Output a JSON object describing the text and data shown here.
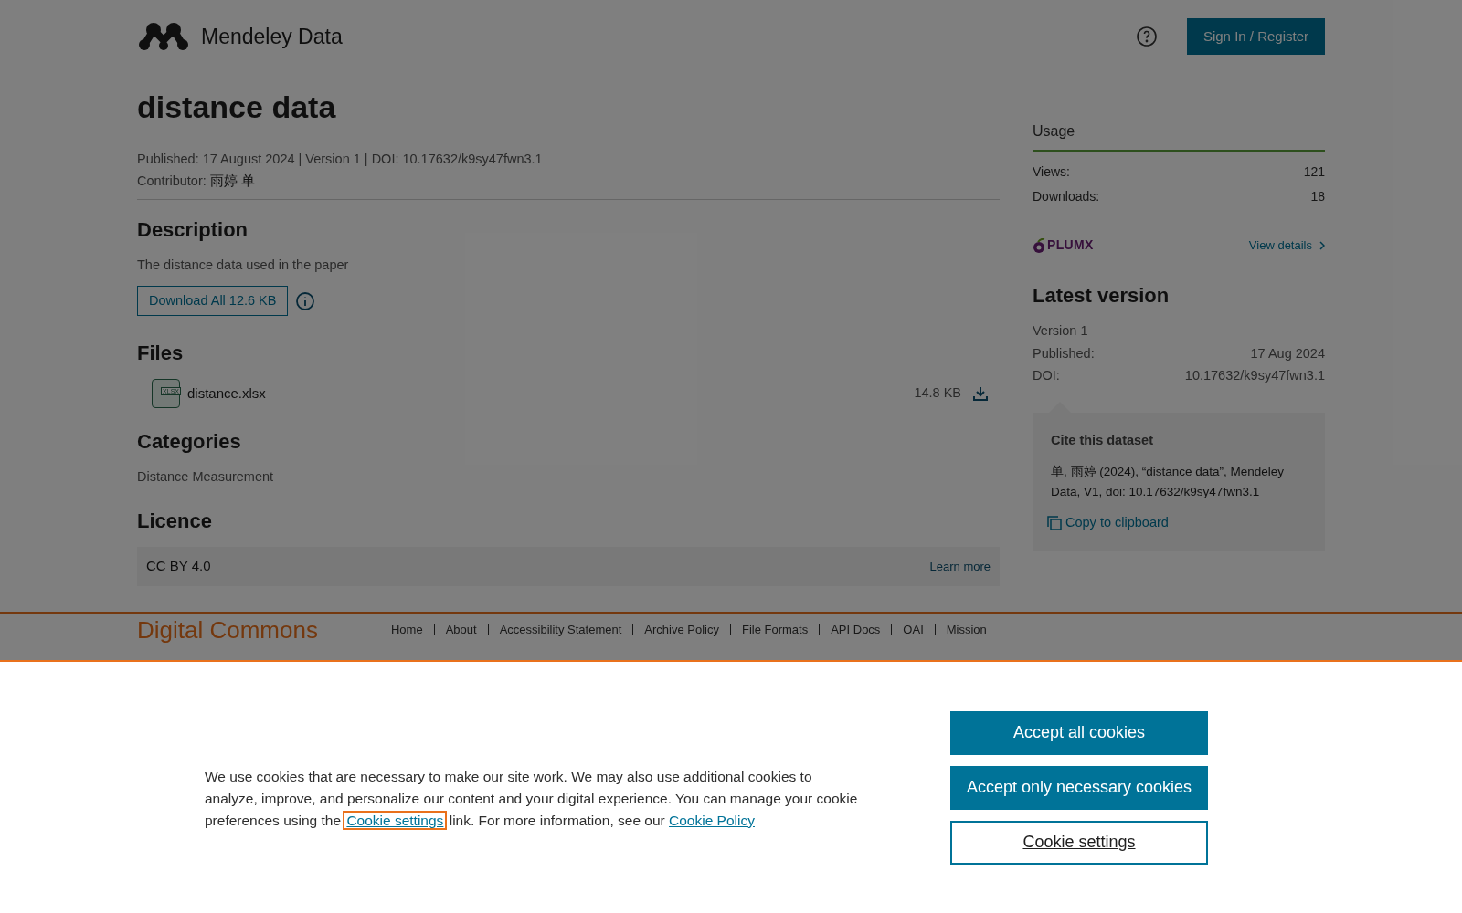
{
  "header": {
    "logo_text": "Mendeley Data",
    "sign_in": "Sign In / Register"
  },
  "dataset": {
    "title": "distance data",
    "meta": "Published: 17 August 2024 | Version 1 | DOI: 10.17632/k9sy47fwn3.1",
    "contributor_label": "Contributor:",
    "contributor": "雨婷 单"
  },
  "description": {
    "heading": "Description",
    "text": "The distance data used in the paper",
    "download": "Download All 12.6 KB"
  },
  "files": {
    "heading": "Files",
    "items": [
      {
        "name": "distance.xlsx",
        "type": "XLSX",
        "size": "14.8 KB"
      }
    ]
  },
  "categories": {
    "heading": "Categories",
    "items": [
      "Distance Measurement"
    ]
  },
  "licence": {
    "heading": "Licence",
    "name": "CC BY 4.0",
    "link": "Learn more"
  },
  "usage": {
    "title": "Usage",
    "stats": [
      {
        "label": "Views:",
        "value": "121"
      },
      {
        "label": "Downloads:",
        "value": "18"
      }
    ],
    "plumx": "PLUMX",
    "details": "View details"
  },
  "latest_version": {
    "title": "Latest version",
    "version": "Version 1",
    "rows": [
      {
        "label": "Published:",
        "value": "17 Aug 2024"
      },
      {
        "label": "DOI:",
        "value": "10.17632/k9sy47fwn3.1"
      }
    ]
  },
  "cite": {
    "title": "Cite this dataset",
    "text": "单, 雨婷 (2024), “distance data”, Mendeley Data, V1, doi: 10.17632/k9sy47fwn3.1",
    "copy": "Copy to clipboard"
  },
  "footer": {
    "brand": "Digital Commons",
    "links": [
      "Home",
      "About",
      "Accessibility Statement",
      "Archive Policy",
      "File Formats",
      "API Docs",
      "OAI",
      "Mission"
    ]
  },
  "cookie_banner": {
    "text_before": "We use cookies that are necessary to make our site work. We may also use additional cookies to analyze, improve, and personalize our content and your digital experience. You can manage your cookie preferences using the",
    "settings_link": {
      "label": "Cookie settings",
      "focused": true
    },
    "text_middle": "link. For more information, see our",
    "policy_link": {
      "label": "Cookie Policy",
      "focused": false
    },
    "buttons": [
      {
        "label": "Accept all cookies",
        "kind": "primary"
      },
      {
        "label": "Accept only necessary cookies",
        "kind": "primary"
      },
      {
        "label": "Cookie settings",
        "kind": "outline"
      }
    ]
  }
}
